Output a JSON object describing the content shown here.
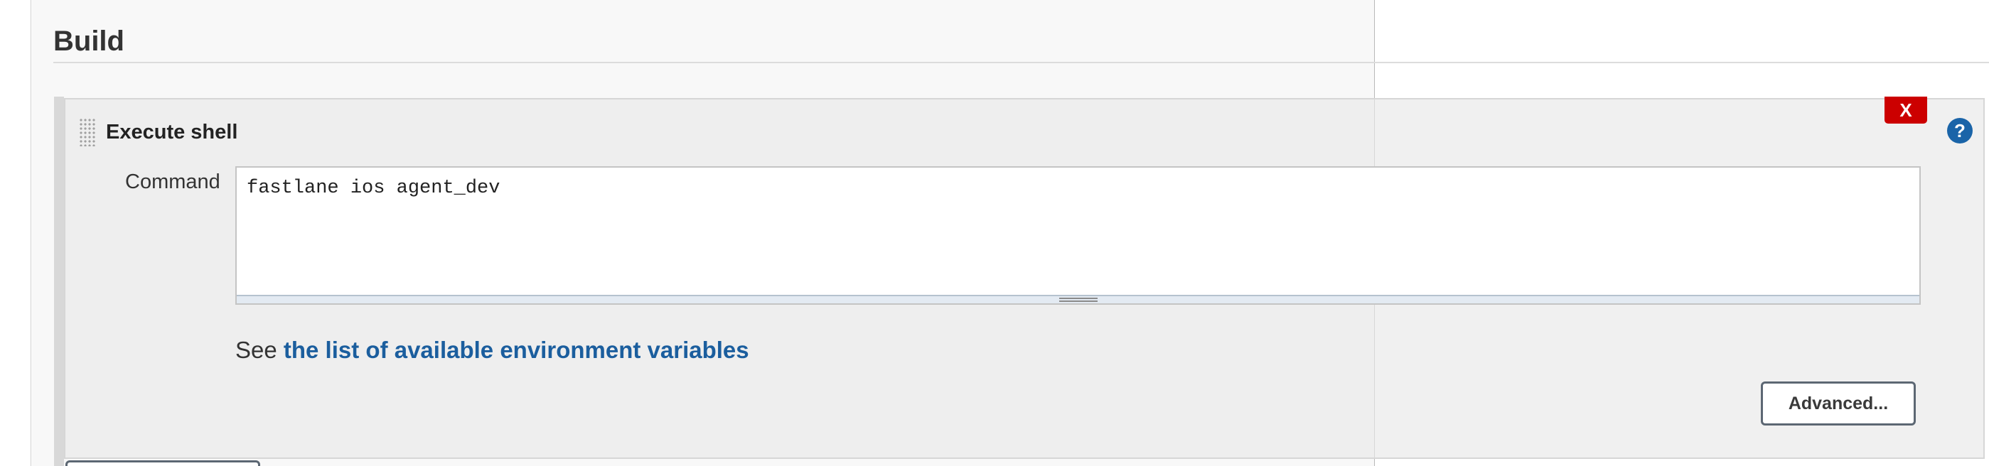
{
  "section": {
    "title": "Build"
  },
  "build_step": {
    "title": "Execute shell",
    "delete_label": "X",
    "help_label": "?",
    "command_label": "Command",
    "command_value": "fastlane ios agent_dev",
    "env_prefix": "See ",
    "env_link": "the list of available environment variables",
    "advanced_label": "Advanced..."
  },
  "colors": {
    "delete": "#cc0000",
    "help": "#1a64a8",
    "link": "#1b5e9e"
  },
  "icons": {
    "drag": "drag-handle-icon",
    "help": "help-icon",
    "delete": "close-icon"
  }
}
